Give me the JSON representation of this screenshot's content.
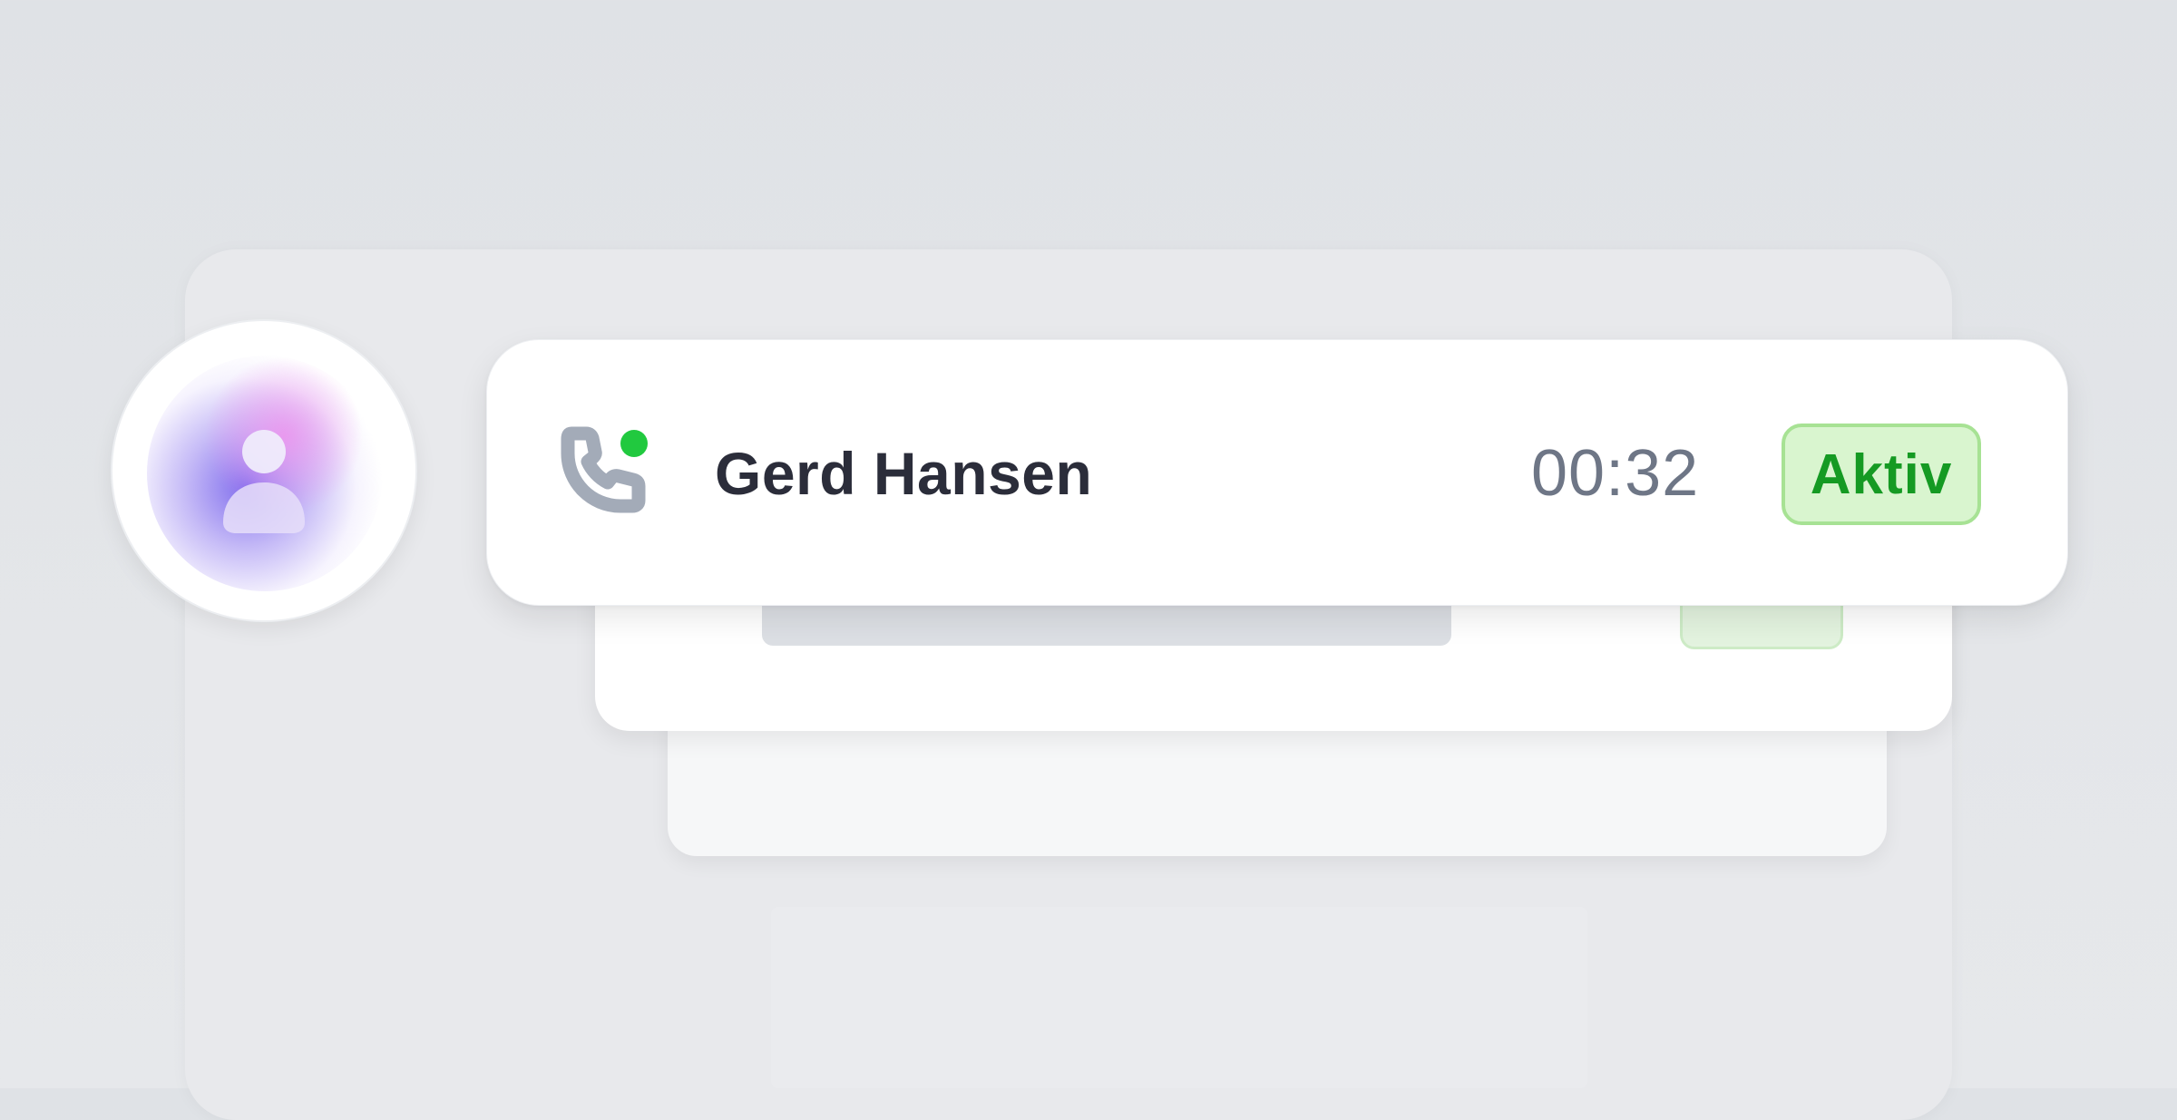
{
  "call": {
    "caller_name": "Gerd Hansen",
    "duration": "00:32",
    "status": "Aktiv",
    "presence": "online"
  },
  "icons": {
    "avatar": "user-avatar-icon",
    "phone": "phone-icon",
    "presence": "online-dot"
  },
  "colors": {
    "status_green": "#159a23",
    "status_bg": "#d9f5cf",
    "presence_green": "#21c93f",
    "avatar_accent": "#7a66ec"
  }
}
